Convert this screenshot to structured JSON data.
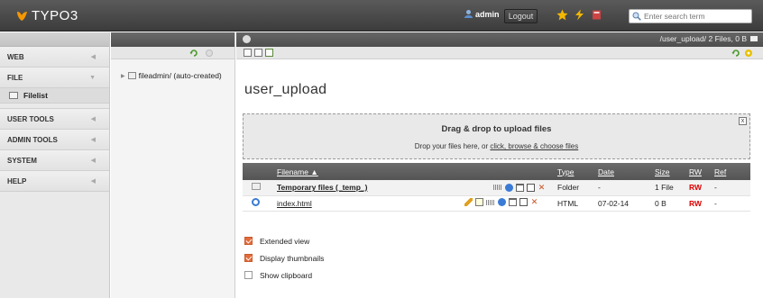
{
  "topbar": {
    "logo_text": "TYPO3",
    "username": "admin",
    "logout_label": "Logout",
    "search_placeholder": "Enter search term",
    "icons": [
      "star-bookmark-icon",
      "lightning-clear-cache-icon",
      "help-book-icon"
    ]
  },
  "modmenu": {
    "groups": [
      {
        "label": "WEB"
      },
      {
        "label": "FILE",
        "items": [
          {
            "label": "Filelist"
          }
        ]
      },
      {
        "label": "USER TOOLS"
      },
      {
        "label": "ADMIN TOOLS"
      },
      {
        "label": "SYSTEM"
      },
      {
        "label": "HELP"
      }
    ]
  },
  "tree": {
    "root_label": "fileadmin/ (auto-created)"
  },
  "docheader": {
    "path": "/user_upload/ 2 Files, 0 B"
  },
  "page": {
    "title": "user_upload"
  },
  "dropzone": {
    "heading": "Drag & drop to upload files",
    "sub_prefix": "Drop your files here, or ",
    "sub_link": "click, browse & choose files",
    "close_label": "x"
  },
  "table": {
    "headers": {
      "filename": "Filename ▲",
      "type": "Type",
      "date": "Date",
      "size": "Size",
      "rw": "RW",
      "ref": "Ref"
    },
    "rows": [
      {
        "name": "Temporary files (_temp_)",
        "type": "Folder",
        "date": "-",
        "size": "1 File",
        "rw": "RW",
        "ref": "-"
      },
      {
        "name": "index.html",
        "type": "HTML",
        "date": "07-02-14",
        "size": "0 B",
        "rw": "RW",
        "ref": "-"
      }
    ]
  },
  "options": {
    "extended_view": {
      "label": "Extended view",
      "checked": true
    },
    "display_thumbnails": {
      "label": "Display thumbnails",
      "checked": true
    },
    "show_clipboard": {
      "label": "Show clipboard",
      "checked": false
    }
  },
  "colors": {
    "accent": "#e46b3a",
    "topbar": "#4a4a4a",
    "rw": "#dd0000"
  }
}
